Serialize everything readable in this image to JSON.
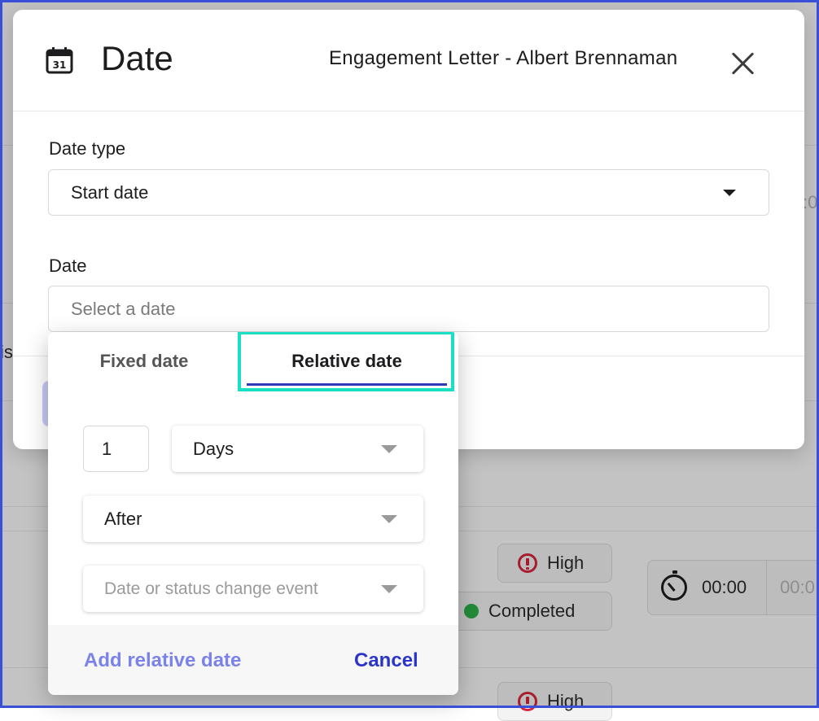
{
  "modal": {
    "title": "Date",
    "subtitle": "Engagement Letter - Albert Brennaman",
    "icon": "calendar-icon",
    "calendar_day": "31",
    "date_type_label": "Date type",
    "date_type_value": "Start date",
    "date_label": "Date",
    "date_placeholder": "Select a date"
  },
  "popover": {
    "tabs": [
      {
        "label": "Fixed date",
        "active": false
      },
      {
        "label": "Relative date",
        "active": true
      }
    ],
    "offset_value": "1",
    "unit_value": "Days",
    "direction_value": "After",
    "event_placeholder": "Date or status change event",
    "add_label": "Add relative date",
    "cancel_label": "Cancel"
  },
  "background": {
    "partial_text_1": "is",
    "partial_text_2": ":0",
    "priority_label": "High",
    "status_label": "Completed",
    "timer_value": "00:00",
    "timer_ghost": "00:0",
    "priority_label_2": "High"
  },
  "colors": {
    "accent": "#2b35c9",
    "accent_light": "#7b82e9",
    "highlight": "#19e0c4",
    "priority": "#d7263d",
    "completed": "#2db24a"
  }
}
